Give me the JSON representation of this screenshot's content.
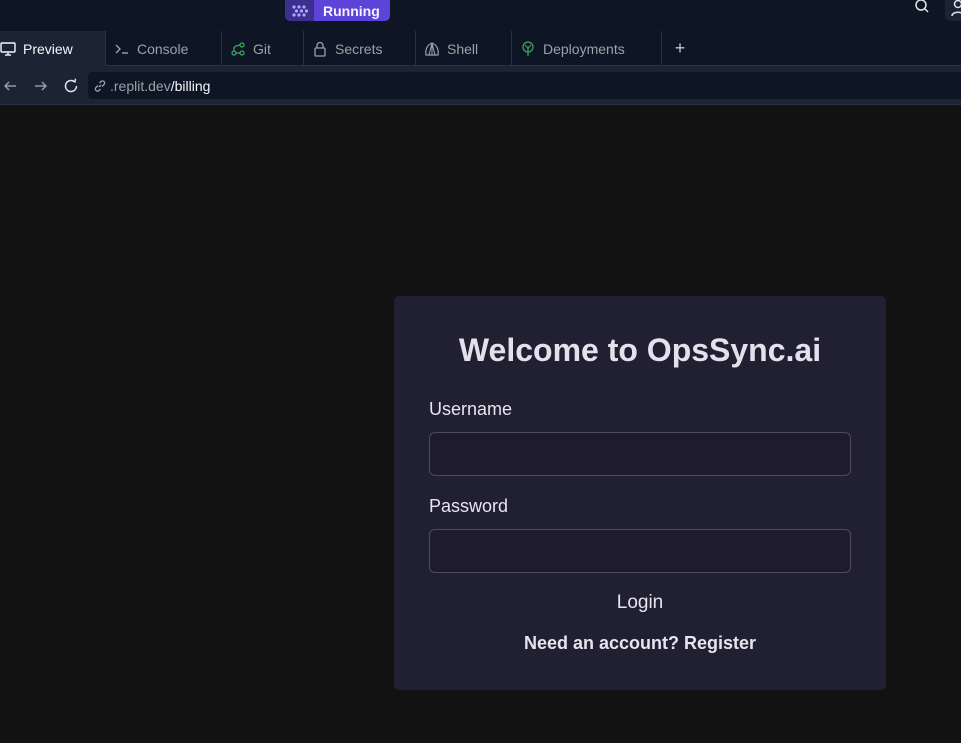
{
  "topbar": {
    "run_label": "Running"
  },
  "tabs": [
    {
      "label": "Preview",
      "icon": "monitor-icon"
    },
    {
      "label": "Console",
      "icon": "terminal-icon"
    },
    {
      "label": "Git",
      "icon": "git-branch-icon"
    },
    {
      "label": "Secrets",
      "icon": "lock-icon"
    },
    {
      "label": "Shell",
      "icon": "shell-icon"
    },
    {
      "label": "Deployments",
      "icon": "deployments-icon"
    }
  ],
  "add_tab_label": "+",
  "urlbar": {
    "host": ".replit.dev",
    "path": "/billing"
  },
  "login": {
    "title": "Welcome to OpsSync.ai",
    "username_label": "Username",
    "username_value": "",
    "password_label": "Password",
    "password_value": "",
    "login_label": "Login",
    "register_prompt": "Need an account?",
    "register_link": "Register"
  },
  "colors": {
    "accent": "#5d43d8",
    "card_bg": "#212033",
    "page_bg": "#121212",
    "chrome_bg": "#0e1525"
  }
}
